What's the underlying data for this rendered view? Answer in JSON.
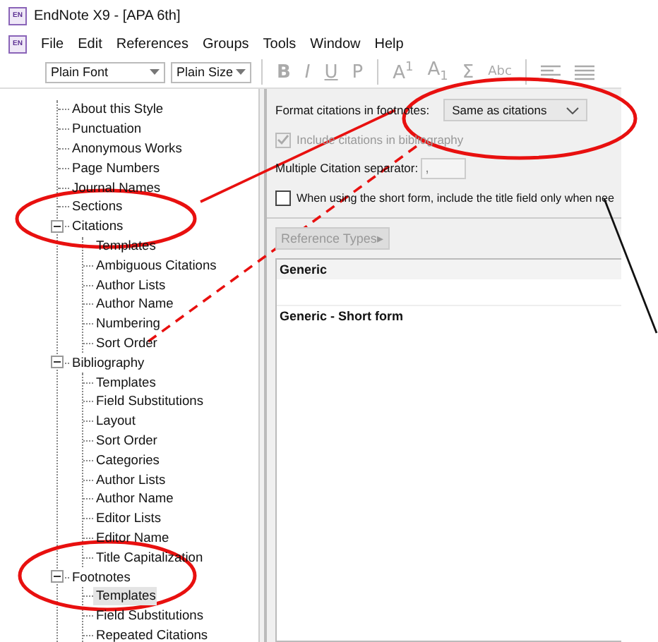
{
  "window": {
    "title": "EndNote X9 - [APA 6th]",
    "icon": "EN"
  },
  "menu_icon": "EN",
  "menu": [
    "File",
    "Edit",
    "References",
    "Groups",
    "Tools",
    "Window",
    "Help"
  ],
  "toolbar": {
    "font": "Plain Font",
    "size": "Plain Size",
    "buttons": [
      {
        "label": "B",
        "kind": "bold",
        "disabled": true
      },
      {
        "label": "I",
        "kind": "italic",
        "disabled": true
      },
      {
        "label": "U",
        "kind": "underline",
        "disabled": true
      },
      {
        "label": "P",
        "kind": "plain",
        "disabled": true
      },
      {
        "label": "A$^{1}$",
        "kind": "separator-before",
        "disabled": true
      },
      {
        "label": "A$_{1}$",
        "kind": "plain",
        "disabled": true
      },
      {
        "label": "Σ",
        "kind": "plain",
        "disabled": true
      },
      {
        "label": "Abc",
        "kind": "small",
        "disabled": true
      }
    ]
  },
  "tree": [
    {
      "label": "About this Style",
      "selected": false
    },
    {
      "label": "Punctuation",
      "selected": false
    },
    {
      "label": "Anonymous Works",
      "selected": false
    },
    {
      "label": "Page Numbers",
      "selected": false
    },
    {
      "label": "Journal Names",
      "selected": false
    },
    {
      "label": "Sections",
      "selected": false
    },
    {
      "label": "Citations",
      "selected": false,
      "expanded": true,
      "children": [
        {
          "label": "Templates",
          "selected": false
        },
        {
          "label": "Ambiguous Citations",
          "selected": false
        },
        {
          "label": "Author Lists",
          "selected": false
        },
        {
          "label": "Author Name",
          "selected": false
        },
        {
          "label": "Numbering",
          "selected": false
        },
        {
          "label": "Sort Order",
          "selected": false
        }
      ]
    },
    {
      "label": "Bibliography",
      "selected": false,
      "expanded": true,
      "children": [
        {
          "label": "Templates",
          "selected": false
        },
        {
          "label": "Field Substitutions",
          "selected": false
        },
        {
          "label": "Layout",
          "selected": false
        },
        {
          "label": "Sort Order",
          "selected": false
        },
        {
          "label": "Categories",
          "selected": false
        },
        {
          "label": "Author Lists",
          "selected": false
        },
        {
          "label": "Author Name",
          "selected": false
        },
        {
          "label": "Editor Lists",
          "selected": false
        },
        {
          "label": "Editor Name",
          "selected": false
        },
        {
          "label": "Title Capitalization",
          "selected": false
        }
      ]
    },
    {
      "label": "Footnotes",
      "selected": false,
      "expanded": true,
      "children": [
        {
          "label": "Templates",
          "selected": true
        },
        {
          "label": "Field Substitutions",
          "selected": false
        },
        {
          "label": "Repeated Citations",
          "selected": false
        }
      ]
    }
  ],
  "footnotes_panel": {
    "format_label": "Format citations in footnotes:",
    "format_value": "Same as citations",
    "include_checkbox": {
      "label": "Include citations in bibliography",
      "checked": true,
      "disabled": true
    },
    "separator_label": "Multiple Citation separator:",
    "separator_value": ",",
    "short_form_checkbox": {
      "label": "When using the short form, include the title field only when nee",
      "checked": false,
      "disabled": false
    },
    "reference_types_button": {
      "label": "Reference Types▸",
      "disabled": true
    },
    "sections": [
      {
        "title": "Generic"
      },
      {
        "title": "Generic - Short form"
      }
    ]
  }
}
